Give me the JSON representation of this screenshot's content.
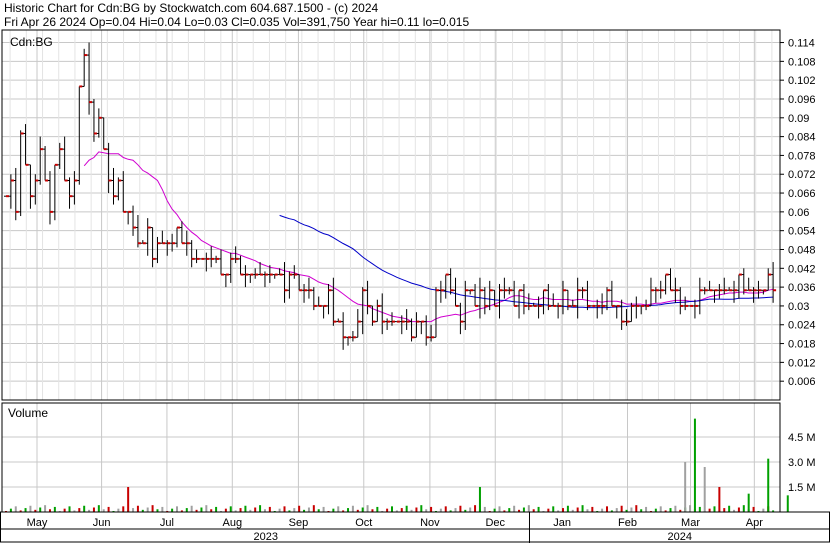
{
  "header": {
    "title": "Historic Chart for Cdn:BG by Stockwatch.com 604.687.1500 - (c) 2024",
    "quote": "Fri Apr 26 2024   Op=0.04  Hi=0.04  Lo=0.03  Cl=0.035  Vol=391,750  Year hi=0.11  lo=0.015"
  },
  "price_panel": {
    "symbol": "Cdn:BG"
  },
  "volume_panel": {
    "label": "Volume"
  },
  "chart_data": [
    {
      "type": "ohlc",
      "ylim": [
        0,
        0.118
      ],
      "y_ticks": [
        "0.114",
        "0.108",
        "0.102",
        "0.096",
        "0.09",
        "0.084",
        "0.078",
        "0.072",
        "0.066",
        "0.06",
        "0.054",
        "0.048",
        "0.042",
        "0.036",
        "0.03",
        "0.024",
        "0.018",
        "0.012",
        "0.006"
      ],
      "month_labels": [
        "May",
        "Jun",
        "Jul",
        "Aug",
        "Sep",
        "Oct",
        "Nov",
        "Dec",
        "Jan",
        "Feb",
        "Mar",
        "Apr"
      ],
      "year_labels": [
        "2023",
        "2024"
      ],
      "grid": true,
      "series": [
        {
          "approx_close": [
            0.065,
            0.07,
            0.06,
            0.085,
            0.075,
            0.065,
            0.07,
            0.08,
            0.07,
            0.06,
            0.075,
            0.08,
            0.07,
            0.065,
            0.07,
            0.1,
            0.11,
            0.095,
            0.085,
            0.09,
            0.08,
            0.07,
            0.065,
            0.07,
            0.06,
            0.06,
            0.055,
            0.05,
            0.05,
            0.055,
            0.045,
            0.05,
            0.05,
            0.05,
            0.05,
            0.055,
            0.05,
            0.05,
            0.045,
            0.045,
            0.045,
            0.045,
            0.045,
            0.045,
            0.04,
            0.04,
            0.045,
            0.045,
            0.04,
            0.04,
            0.04,
            0.04,
            0.04,
            0.04,
            0.04,
            0.04,
            0.04,
            0.035,
            0.04,
            0.04,
            0.035,
            0.035,
            0.035,
            0.03,
            0.03,
            0.03,
            0.035,
            0.025,
            0.025,
            0.02,
            0.02,
            0.02,
            0.025,
            0.035,
            0.03,
            0.025,
            0.03,
            0.025,
            0.025,
            0.025,
            0.025,
            0.025,
            0.025,
            0.02,
            0.025,
            0.025,
            0.02,
            0.02,
            0.035,
            0.035,
            0.04,
            0.035,
            0.03,
            0.025,
            0.035,
            0.035,
            0.03,
            0.035,
            0.03,
            0.035,
            0.03,
            0.035,
            0.035,
            0.035,
            0.03,
            0.035,
            0.03,
            0.03,
            0.03,
            0.03,
            0.035,
            0.03,
            0.03,
            0.03,
            0.035,
            0.03,
            0.03,
            0.035,
            0.035,
            0.03,
            0.03,
            0.03,
            0.03,
            0.035,
            0.03,
            0.03,
            0.025,
            0.025,
            0.03,
            0.03,
            0.03,
            0.03,
            0.035,
            0.035,
            0.035,
            0.04,
            0.035,
            0.035,
            0.03,
            0.03,
            0.03,
            0.03,
            0.035,
            0.035,
            0.035,
            0.035,
            0.035,
            0.035,
            0.035,
            0.035,
            0.04,
            0.035,
            0.035,
            0.035,
            0.035,
            0.035,
            0.04,
            0.035
          ]
        }
      ],
      "moving_averages": [
        {
          "color": "#d000d0",
          "start_index": 16
        },
        {
          "color": "#0000c8",
          "start_index": 56
        }
      ]
    },
    {
      "type": "bar",
      "title": "Volume",
      "ylim": [
        0,
        6300000
      ],
      "y_ticks": [
        "4.5 M",
        "3.0 M",
        "1.5 M"
      ],
      "y_tick_values": [
        4500000,
        3000000,
        1500000
      ],
      "spikes": [
        {
          "index": 25,
          "value": 1500000,
          "color": "#c80000"
        },
        {
          "index": 97,
          "value": 1500000,
          "color": "#00a000"
        },
        {
          "index": 139,
          "value": 3000000,
          "color": "#a0a0a0"
        },
        {
          "index": 141,
          "value": 5600000,
          "color": "#00a000"
        },
        {
          "index": 143,
          "value": 2700000,
          "color": "#a0a0a0"
        },
        {
          "index": 146,
          "value": 1500000,
          "color": "#c80000"
        },
        {
          "index": 152,
          "value": 1100000,
          "color": "#00a000"
        },
        {
          "index": 156,
          "value": 3200000,
          "color": "#00a000"
        },
        {
          "index": 160,
          "value": 1000000,
          "color": "#00a000"
        }
      ]
    }
  ]
}
